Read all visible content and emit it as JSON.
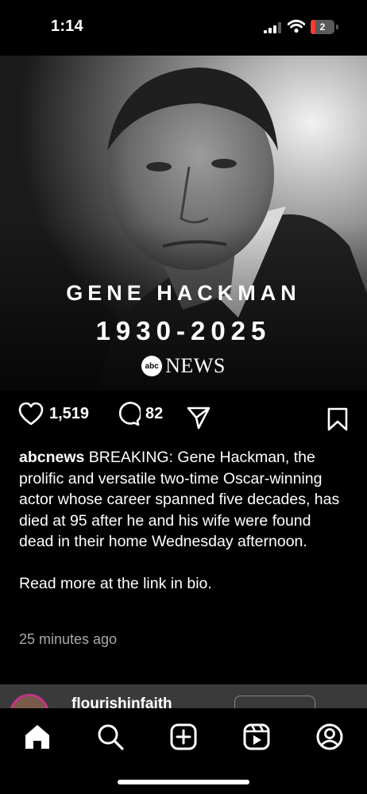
{
  "status_bar": {
    "time": "1:14",
    "battery": "2",
    "battery_level": 0.2
  },
  "post": {
    "image": {
      "name": "GENE HACKMAN",
      "years": "1930-2025",
      "logo_abc": "abc",
      "logo_news": "NEWS"
    },
    "actions": {
      "likes": "1,519",
      "comments": "82"
    },
    "caption": {
      "username": "abcnews",
      "text": " BREAKING: Gene Hackman, the prolific and versatile two-time Oscar-winning actor whose career spanned five decades, has died at 95 after he and his wife were found dead in their home Wednesday afternoon.",
      "read_more": "Read more at the link in bio."
    },
    "timestamp": "25 minutes ago"
  },
  "next_post": {
    "username": "flourishinfaith"
  },
  "bottom_nav": [
    "home-icon",
    "search-icon",
    "create-post-icon",
    "reels-icon",
    "profile-icon"
  ]
}
